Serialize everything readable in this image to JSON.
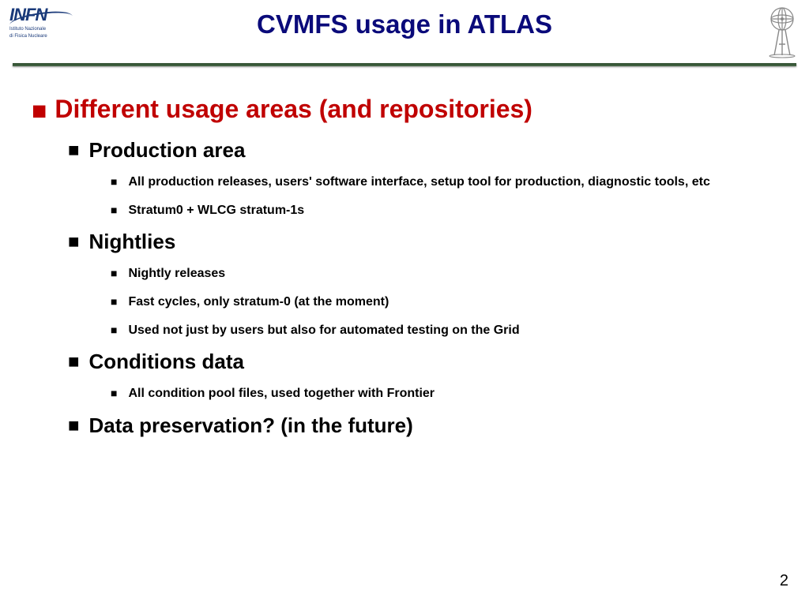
{
  "header": {
    "title": "CVMFS usage in ATLAS",
    "logo_left_text": "INFN",
    "logo_left_sub1": "Istituto Nazionale",
    "logo_left_sub2": "di Fisica Nucleare"
  },
  "main": {
    "heading": "Different usage areas (and repositories)"
  },
  "sections": {
    "production": {
      "title": "Production area",
      "items": [
        "All production releases, users' software interface, setup tool for production, diagnostic tools, etc",
        "Stratum0 + WLCG stratum-1s"
      ]
    },
    "nightlies": {
      "title": "Nightlies",
      "items": [
        "Nightly releases",
        "Fast cycles, only stratum-0 (at the moment)",
        "Used not just by users but also for automated testing on the Grid"
      ]
    },
    "conditions": {
      "title": "Conditions data",
      "items": [
        "All condition pool files, used together with Frontier"
      ]
    },
    "datapres": {
      "title": "Data preservation? (in the future)"
    }
  },
  "footer": {
    "page_number": "2"
  }
}
